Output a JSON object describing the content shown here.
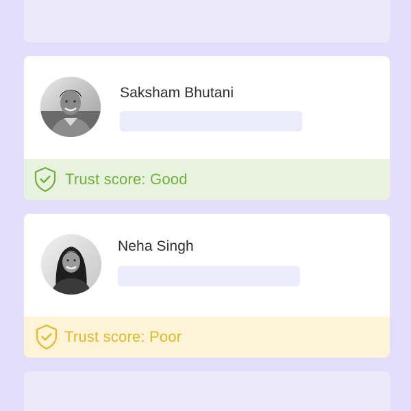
{
  "users": [
    {
      "name": "Saksham Bhutani",
      "trust_label": "Trust score: Good",
      "status_color": "#74ad3c"
    },
    {
      "name": "Neha Singh",
      "trust_label": "Trust score: Poor",
      "status_color": "#e2b826"
    }
  ],
  "icons": {
    "trust": "shield-check-icon"
  }
}
